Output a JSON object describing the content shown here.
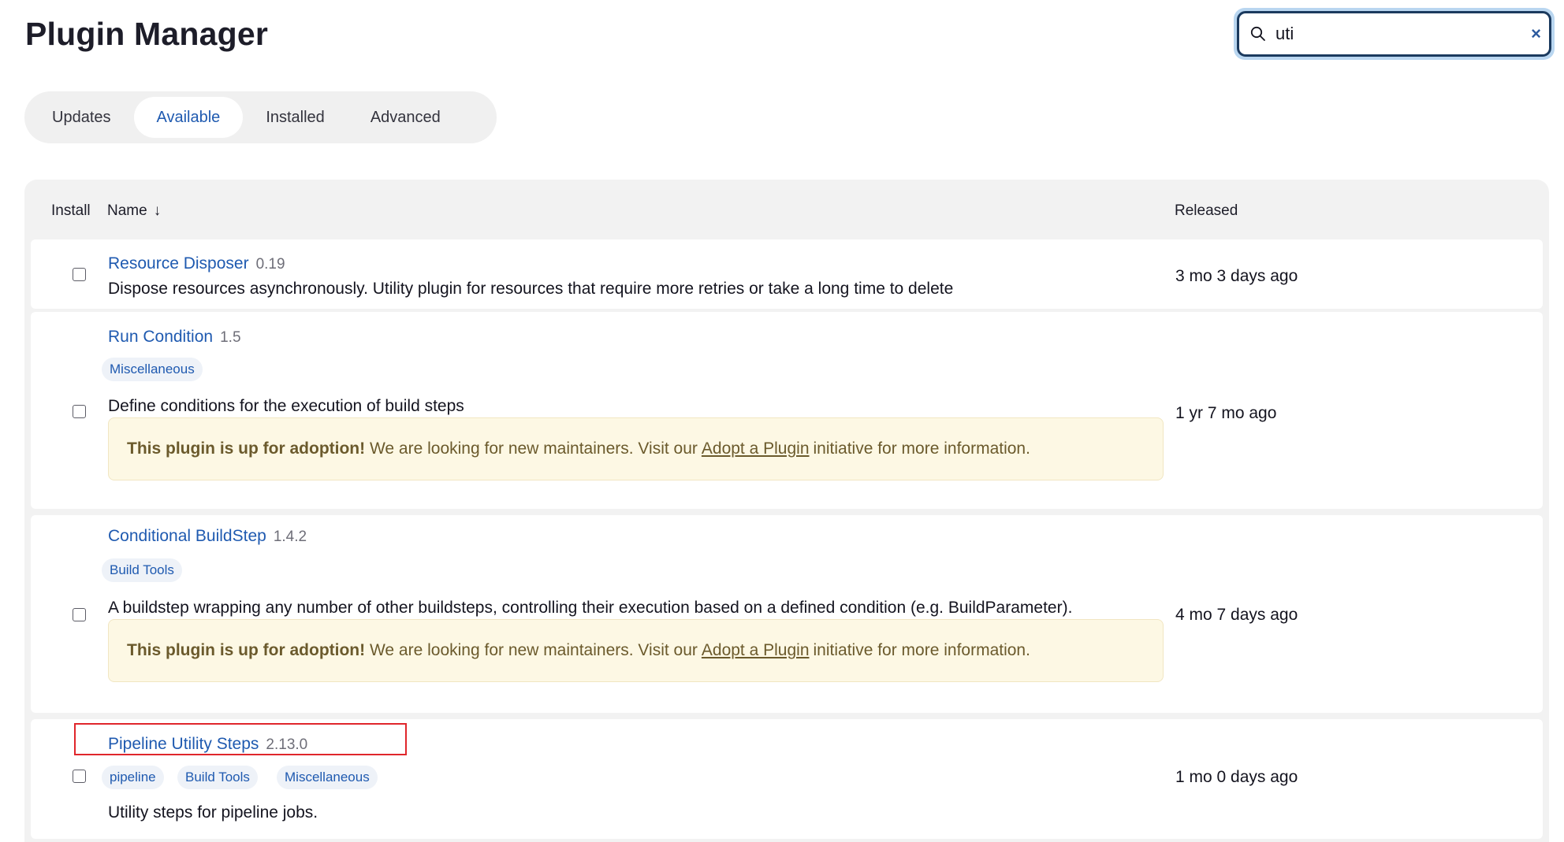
{
  "page": {
    "title": "Plugin Manager"
  },
  "search": {
    "value": "uti",
    "clear_label": "×"
  },
  "tabs": [
    {
      "label": "Updates",
      "active": false
    },
    {
      "label": "Available",
      "active": true
    },
    {
      "label": "Installed",
      "active": false
    },
    {
      "label": "Advanced",
      "active": false
    }
  ],
  "table": {
    "headers": {
      "install": "Install",
      "name": "Name",
      "name_sort": "↓",
      "released": "Released"
    },
    "adoption_notice": {
      "bold": "This plugin is up for adoption!",
      "pre": "We are looking for new maintainers. Visit our",
      "link": "Adopt a Plugin",
      "post": "initiative for more information."
    },
    "rows": [
      {
        "name": "Resource Disposer",
        "version": "0.19",
        "description": "Dispose resources asynchronously. Utility plugin for resources that require more retries or take a long time to delete",
        "released": "3 mo 3 days ago"
      },
      {
        "name": "Run Condition",
        "version": "1.5",
        "tags": [
          "Miscellaneous"
        ],
        "description": "Define conditions for the execution of build steps",
        "released": "1 yr 7 mo ago",
        "adoption": true
      },
      {
        "name": "Conditional BuildStep",
        "version": "1.4.2",
        "tags": [
          "Build Tools"
        ],
        "description": "A buildstep wrapping any number of other buildsteps, controlling their execution based on a defined condition (e.g. BuildParameter).",
        "released": "4 mo 7 days ago",
        "adoption": true
      },
      {
        "name": "Pipeline Utility Steps",
        "version": "2.13.0",
        "tags": [
          "pipeline",
          "Build Tools",
          "Miscellaneous"
        ],
        "description": "Utility steps for pipeline jobs.",
        "released": "1 mo 0 days ago"
      }
    ]
  },
  "colors": {
    "link": "#1f5ab0",
    "highlight": "#e0262b",
    "adoption_bg": "#fdf8e4"
  }
}
